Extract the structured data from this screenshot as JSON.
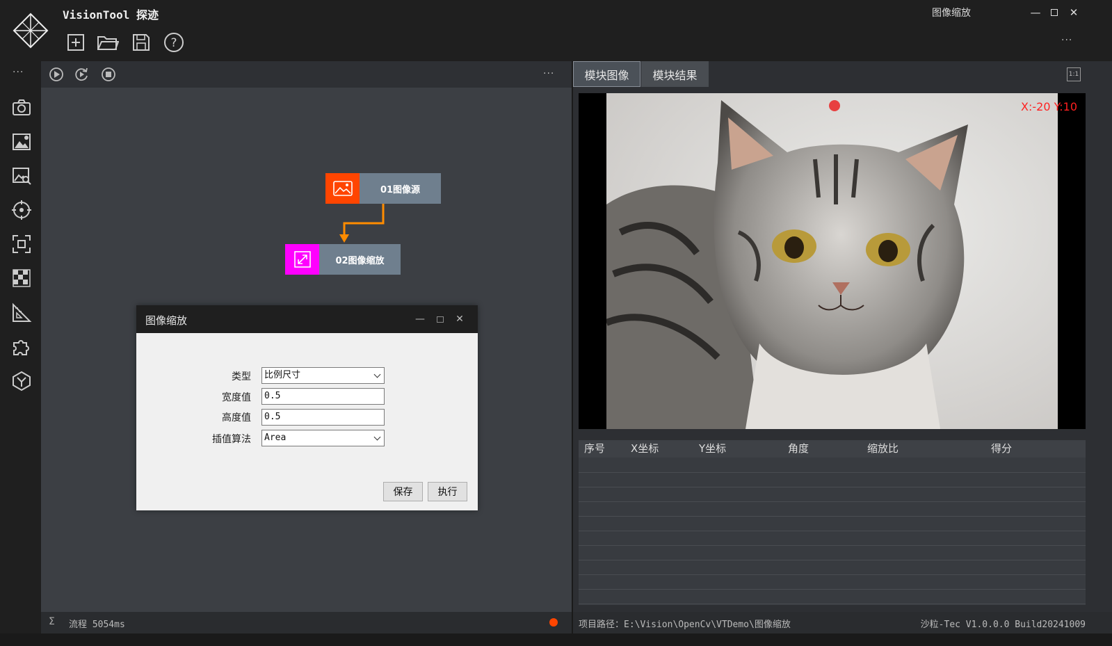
{
  "app": {
    "title": "VisionTool 探迹",
    "window_name": "图像缩放"
  },
  "flow": {
    "nodes": [
      {
        "label": "01图像源",
        "color": "#ff4500"
      },
      {
        "label": "02图像缩放",
        "color": "#ff00ff"
      }
    ],
    "status_label": "流程 5054ms"
  },
  "dialog": {
    "title": "图像缩放",
    "fields": {
      "type_label": "类型",
      "type_value": "比例尺寸",
      "width_label": "宽度值",
      "width_value": "0.5",
      "height_label": "高度值",
      "height_value": "0.5",
      "interp_label": "插值算法",
      "interp_value": "Area"
    },
    "save_label": "保存",
    "execute_label": "执行"
  },
  "right": {
    "tabs": [
      "模块图像",
      "模块结果"
    ],
    "one_to_one": "1:1",
    "coord_readout": "X:-20 Y:10",
    "table_headers": [
      "序号",
      "X坐标",
      "Y坐标",
      "角度",
      "缩放比",
      "得分"
    ]
  },
  "status": {
    "project_path": "项目路径：E:\\Vision\\OpenCv\\VTDemo\\图像缩放",
    "build": "沙粒-Tec V1.0.0.0 Build20241009"
  },
  "colors": {
    "accent_orange": "#ff8c00",
    "status_dot": "#ff4500"
  }
}
